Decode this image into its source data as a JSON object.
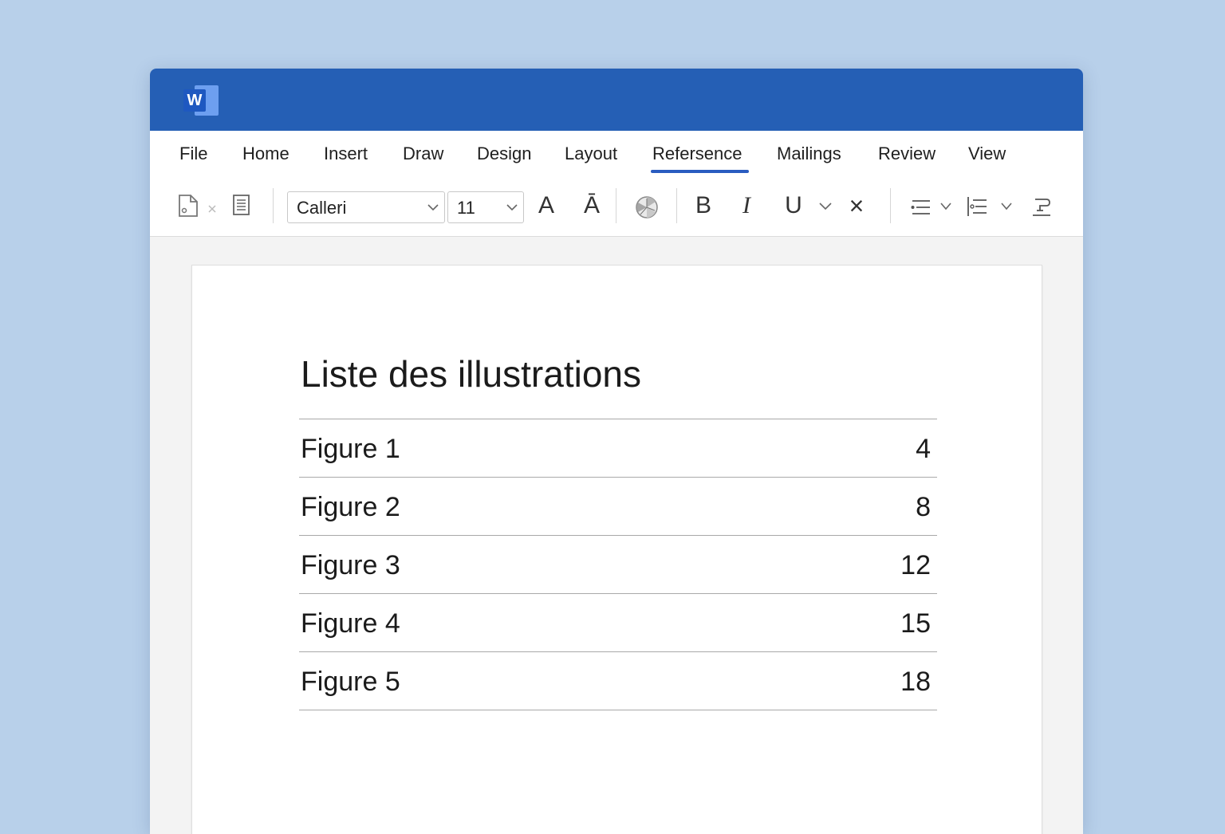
{
  "app": {
    "logo_letter": "W",
    "brand_color": "#255fb5"
  },
  "menu": {
    "items": [
      {
        "label": "File"
      },
      {
        "label": "Home"
      },
      {
        "label": "Insert"
      },
      {
        "label": "Draw"
      },
      {
        "label": "Design"
      },
      {
        "label": "Layout"
      },
      {
        "label": "Refersence",
        "active": true
      },
      {
        "label": "Mailings"
      },
      {
        "label": "Review"
      },
      {
        "label": "View"
      }
    ]
  },
  "toolbar": {
    "font_name": "Calleri",
    "font_size": "11",
    "grow_font_label": "A",
    "shrink_font_label": "Ā",
    "bold_label": "B",
    "italic_label": "I",
    "underline_label": "U",
    "clear_label": "×",
    "icons": [
      "new-page-icon",
      "close-small-icon",
      "document-list-icon",
      "color-wheel-icon",
      "bullet-list-icon",
      "numbered-list-icon",
      "format-painter-icon"
    ]
  },
  "document": {
    "title": "Liste des illustrations",
    "entries": [
      {
        "label": "Figure 1",
        "page": "4"
      },
      {
        "label": "Figure 2",
        "page": "8"
      },
      {
        "label": "Figure 3",
        "page": "12"
      },
      {
        "label": "Figure 4",
        "page": "15"
      },
      {
        "label": "Figure 5",
        "page": "18"
      }
    ]
  }
}
